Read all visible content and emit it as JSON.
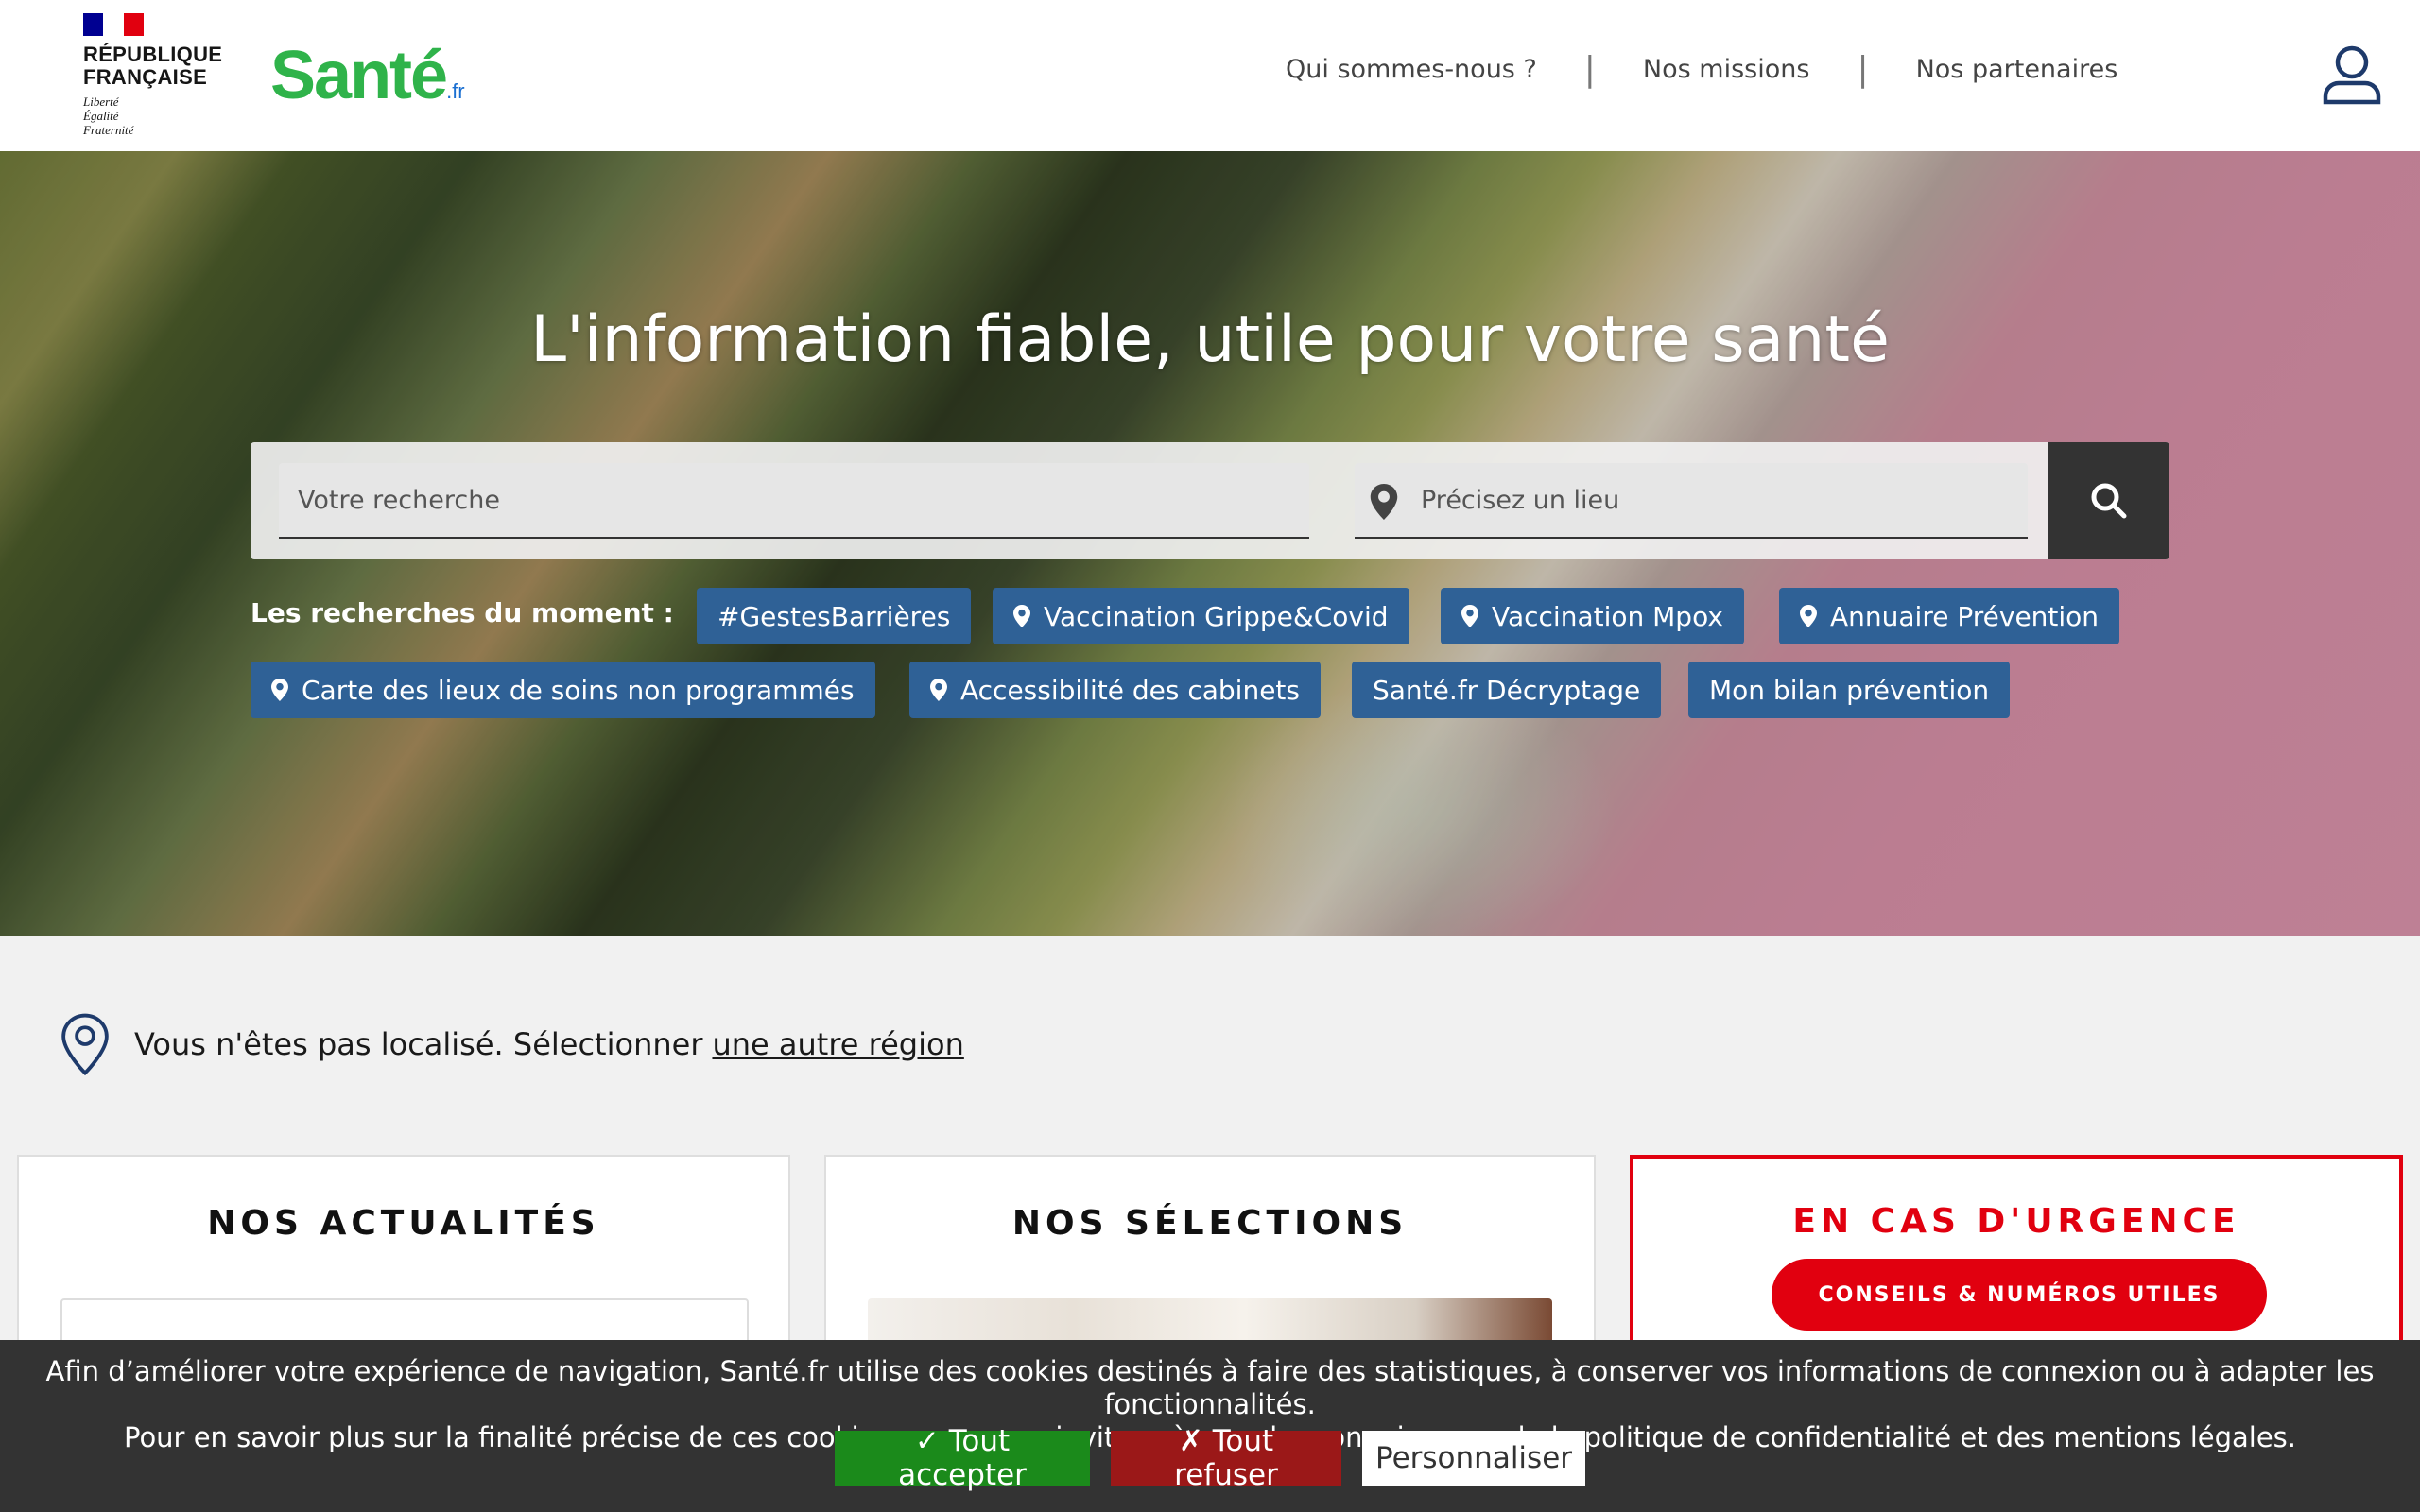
{
  "header": {
    "rf_title_line1": "RÉPUBLIQUE",
    "rf_title_line2": "FRANÇAISE",
    "rf_motto_1": "Liberté",
    "rf_motto_2": "Égalité",
    "rf_motto_3": "Fraternité",
    "logo_main": "Santé",
    "logo_suffix": ".fr",
    "nav": [
      {
        "label": "Qui sommes-nous ?"
      },
      {
        "label": "Nos missions"
      },
      {
        "label": "Nos partenaires"
      }
    ],
    "nav_separator": "|",
    "account_icon": "user-icon"
  },
  "hero": {
    "title": "L'information fiable, utile pour votre santé",
    "search_placeholder": "Votre recherche",
    "location_placeholder": "Précisez un lieu",
    "search_icon": "search-icon",
    "trending_label": "Les recherches du moment :",
    "chips": [
      {
        "label": "#GestesBarrières",
        "icon": ""
      },
      {
        "label": "Vaccination Grippe&Covid",
        "icon": "map-pin-icon"
      },
      {
        "label": "Vaccination Mpox",
        "icon": "map-pin-icon"
      },
      {
        "label": "Annuaire Prévention",
        "icon": "map-pin-icon"
      },
      {
        "label": "Carte des lieux de soins non programmés",
        "icon": "map-pin-icon"
      },
      {
        "label": "Accessibilité des cabinets",
        "icon": "map-pin-icon"
      },
      {
        "label": "Santé.fr Décryptage",
        "icon": ""
      },
      {
        "label": "Mon bilan prévention",
        "icon": ""
      }
    ]
  },
  "region": {
    "text": "Vous n'êtes pas localisé.  Sélectionner",
    "link": "une autre région"
  },
  "cards": {
    "news_title": "NOS ACTUALITÉS",
    "selections_title": "NOS SÉLECTIONS",
    "urgency_title": "EN CAS D'URGENCE",
    "urgency_button": "CONSEILS & NUMÉROS UTILES"
  },
  "cookie": {
    "line1": "Afin d’améliorer votre expérience de navigation, Santé.fr utilise des cookies destinés à faire des statistiques, à conserver vos informations de connexion ou à adapter les fonctionnalités.",
    "line2": "Pour en savoir plus sur la finalité précise de ces cookies, nous vous invitons à prendre connaissance de la politique de confidentialité et des mentions légales.",
    "accept": "✓ Tout accepter",
    "refuse": "✗ Tout refuser",
    "customize": "Personnaliser"
  },
  "colors": {
    "chip_blue": "#2f6196",
    "urgency_red": "#e1000f",
    "logo_blue": "#1a6fd1",
    "logo_green": "#2fb34a",
    "cookie_accept": "#1b8a1b",
    "cookie_refuse": "#9b1818"
  }
}
